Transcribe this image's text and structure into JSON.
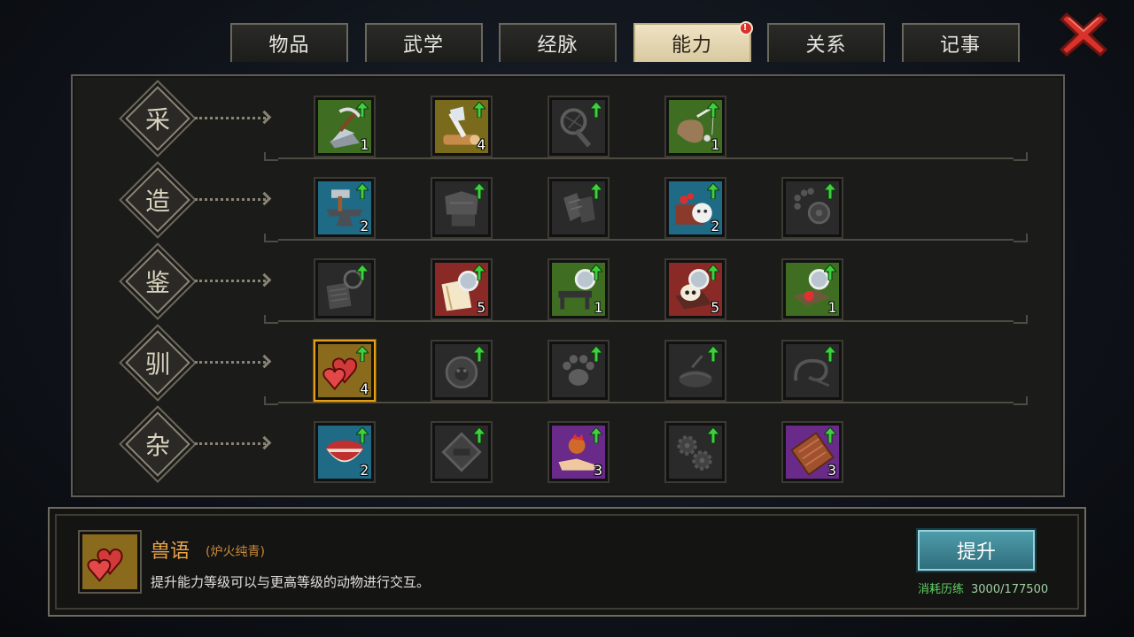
{
  "tabs": [
    {
      "label": "物品",
      "active": false
    },
    {
      "label": "武学",
      "active": false
    },
    {
      "label": "经脉",
      "active": false
    },
    {
      "label": "能力",
      "active": true,
      "notify": "!"
    },
    {
      "label": "关系",
      "active": false
    },
    {
      "label": "记事",
      "active": false
    }
  ],
  "rows": [
    {
      "category": "采",
      "skills": [
        {
          "icon": "mining-pickaxe-icon",
          "bg": "#3f6e22",
          "level": "1",
          "active": true
        },
        {
          "icon": "woodcutting-axe-icon",
          "bg": "#7a6a1c",
          "level": "4",
          "active": true
        },
        {
          "icon": "bug-net-icon",
          "bg": "#2a2a2a",
          "level": "",
          "active": false
        },
        {
          "icon": "fishing-rod-icon",
          "bg": "#3f6e22",
          "level": "1",
          "active": true
        }
      ]
    },
    {
      "category": "造",
      "skills": [
        {
          "icon": "anvil-hammer-icon",
          "bg": "#1f6a85",
          "level": "2",
          "active": true
        },
        {
          "icon": "tailoring-icon",
          "bg": "#2a2a2a",
          "level": "",
          "active": false
        },
        {
          "icon": "gloves-crafting-icon",
          "bg": "#2a2a2a",
          "level": "",
          "active": false
        },
        {
          "icon": "cooking-box-icon",
          "bg": "#1f6a85",
          "level": "2",
          "active": true
        },
        {
          "icon": "beads-wheel-icon",
          "bg": "#2a2a2a",
          "level": "",
          "active": false
        }
      ]
    },
    {
      "category": "鉴",
      "skills": [
        {
          "icon": "scroll-magnifier-icon",
          "bg": "#2a2a2a",
          "level": "",
          "active": false
        },
        {
          "icon": "book-magnifier-icon",
          "bg": "#8a2a26",
          "level": "5",
          "active": true
        },
        {
          "icon": "bench-magnifier-icon",
          "bg": "#3f6e22",
          "level": "1",
          "active": true
        },
        {
          "icon": "skull-magnifier-icon",
          "bg": "#8a2a26",
          "level": "5",
          "active": true
        },
        {
          "icon": "gem-magnifier-icon",
          "bg": "#3f6e22",
          "level": "1",
          "active": true
        }
      ]
    },
    {
      "category": "驯",
      "skills": [
        {
          "icon": "hearts-icon",
          "bg": "#8a6a1c",
          "level": "4",
          "active": true,
          "selected": true
        },
        {
          "icon": "beast-aura-icon",
          "bg": "#2a2a2a",
          "level": "",
          "active": false
        },
        {
          "icon": "paw-icon",
          "bg": "#2a2a2a",
          "level": "",
          "active": false
        },
        {
          "icon": "nest-icon",
          "bg": "#2a2a2a",
          "level": "",
          "active": false
        },
        {
          "icon": "whip-icon",
          "bg": "#2a2a2a",
          "level": "",
          "active": false
        }
      ]
    },
    {
      "category": "杂",
      "skills": [
        {
          "icon": "teacup-icon",
          "bg": "#1f6a85",
          "level": "2",
          "active": true
        },
        {
          "icon": "disc-tool-icon",
          "bg": "#2a2a2a",
          "level": "",
          "active": false
        },
        {
          "icon": "hand-rooster-icon",
          "bg": "#6a2a8a",
          "level": "3",
          "active": true
        },
        {
          "icon": "gears-icon",
          "bg": "#2a2a2a",
          "level": "",
          "active": false
        },
        {
          "icon": "chocolate-bar-icon",
          "bg": "#6a2a8a",
          "level": "3",
          "active": true
        }
      ]
    }
  ],
  "detail": {
    "icon": "hearts-icon",
    "name": "兽语",
    "subtitle": "(炉火纯青)",
    "description": "提升能力等级可以与更高等级的动物进行交互。",
    "button_label": "提升",
    "cost_label": "消耗历练",
    "cost_value": "3000/177500"
  },
  "colors": {
    "selected_border": "#e6a018",
    "upgrade_arrow": "#3fcf3f",
    "cost_green": "#5fd163",
    "close_red": "#d8322a"
  }
}
